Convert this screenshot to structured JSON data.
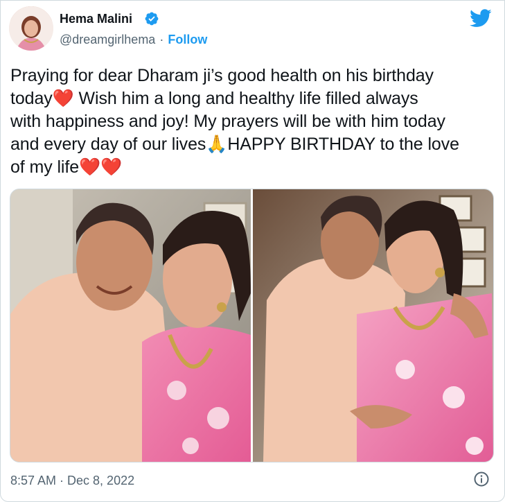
{
  "author": {
    "name": "Hema Malini",
    "handle": "@dreamgirlhema",
    "separator": "·",
    "follow_label": "Follow"
  },
  "tweet": {
    "line1": "Praying for dear Dharam ji’s good health on his birthday",
    "line2a": "today",
    "line2b": " Wish him a long and healthy life filled always",
    "line3": "with happiness and joy! My prayers will be with him today",
    "line4a": "and every day of our lives",
    "line4b": "HAPPY BIRTHDAY to the love",
    "line5a": "of my life",
    "heart_emoji": "❤️",
    "pray_emoji": "🙏"
  },
  "media": {
    "count": 2,
    "items": [
      {
        "icon": "photo-couple-1"
      },
      {
        "icon": "photo-couple-2"
      }
    ]
  },
  "footer": {
    "timestamp": "8:57 AM · Dec 8, 2022"
  },
  "colors": {
    "text": "#0f1419",
    "secondary": "#536471",
    "accent": "#1d9bf0",
    "heart": "#dd2e44",
    "border": "#cfd9de"
  },
  "icons": {
    "verified": "verified-badge-icon",
    "brand": "twitter-bird-icon",
    "info": "info-icon"
  }
}
